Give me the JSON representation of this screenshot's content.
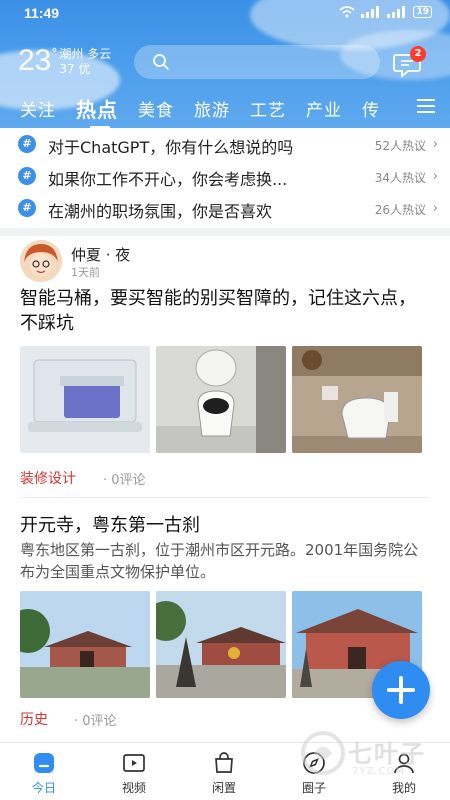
{
  "status_bar": {
    "time": "11:49",
    "signal_text": "4G",
    "battery": "19"
  },
  "weather": {
    "temperature": "23",
    "unit": "°",
    "city": "潮州",
    "condition": "多云",
    "aqi": "37 优"
  },
  "search": {
    "placeholder": ""
  },
  "messages": {
    "badge_count": "2"
  },
  "tabs": [
    {
      "label": "关注"
    },
    {
      "label": "热点"
    },
    {
      "label": "美食"
    },
    {
      "label": "旅游"
    },
    {
      "label": "工艺"
    },
    {
      "label": "产业"
    },
    {
      "label": "传"
    }
  ],
  "hot_topics": [
    {
      "icon": "#",
      "title": "对于ChatGPT，你有什么想说的吗",
      "count": "52人热议"
    },
    {
      "icon": "#",
      "title": "如果你工作不开心，你会考虑换...",
      "count": "34人热议"
    },
    {
      "icon": "#",
      "title": "在潮州的职场氛围，你是否喜欢",
      "count": "26人热议"
    }
  ],
  "post1": {
    "author": "仲夏 · 夜",
    "time": "1天前",
    "title": "智能马桶，要买智能的别买智障的，记住这六点，不踩坑",
    "tag": "装修设计",
    "comments": "· 0评论"
  },
  "post2": {
    "title": "开元寺，粤东第一古刹",
    "description": "粤东地区第一古刹，位于潮州市区开元路。2001年国务院公布为全国重点文物保护单位。",
    "tag": "历史",
    "comments": "· 0评论"
  },
  "bottom_nav": [
    {
      "label": "今日",
      "icon": "home-icon"
    },
    {
      "label": "视频",
      "icon": "video-icon"
    },
    {
      "label": "闲置",
      "icon": "bag-icon"
    },
    {
      "label": "圈子",
      "icon": "compass-icon"
    },
    {
      "label": "我的",
      "icon": "user-icon"
    }
  ],
  "watermark": {
    "text": "七叶子",
    "sub": "7YZ.COM"
  },
  "colors": {
    "accent": "#2f8cf0",
    "tag_red": "#d6332f",
    "header_blue": "#3b8fe6"
  }
}
